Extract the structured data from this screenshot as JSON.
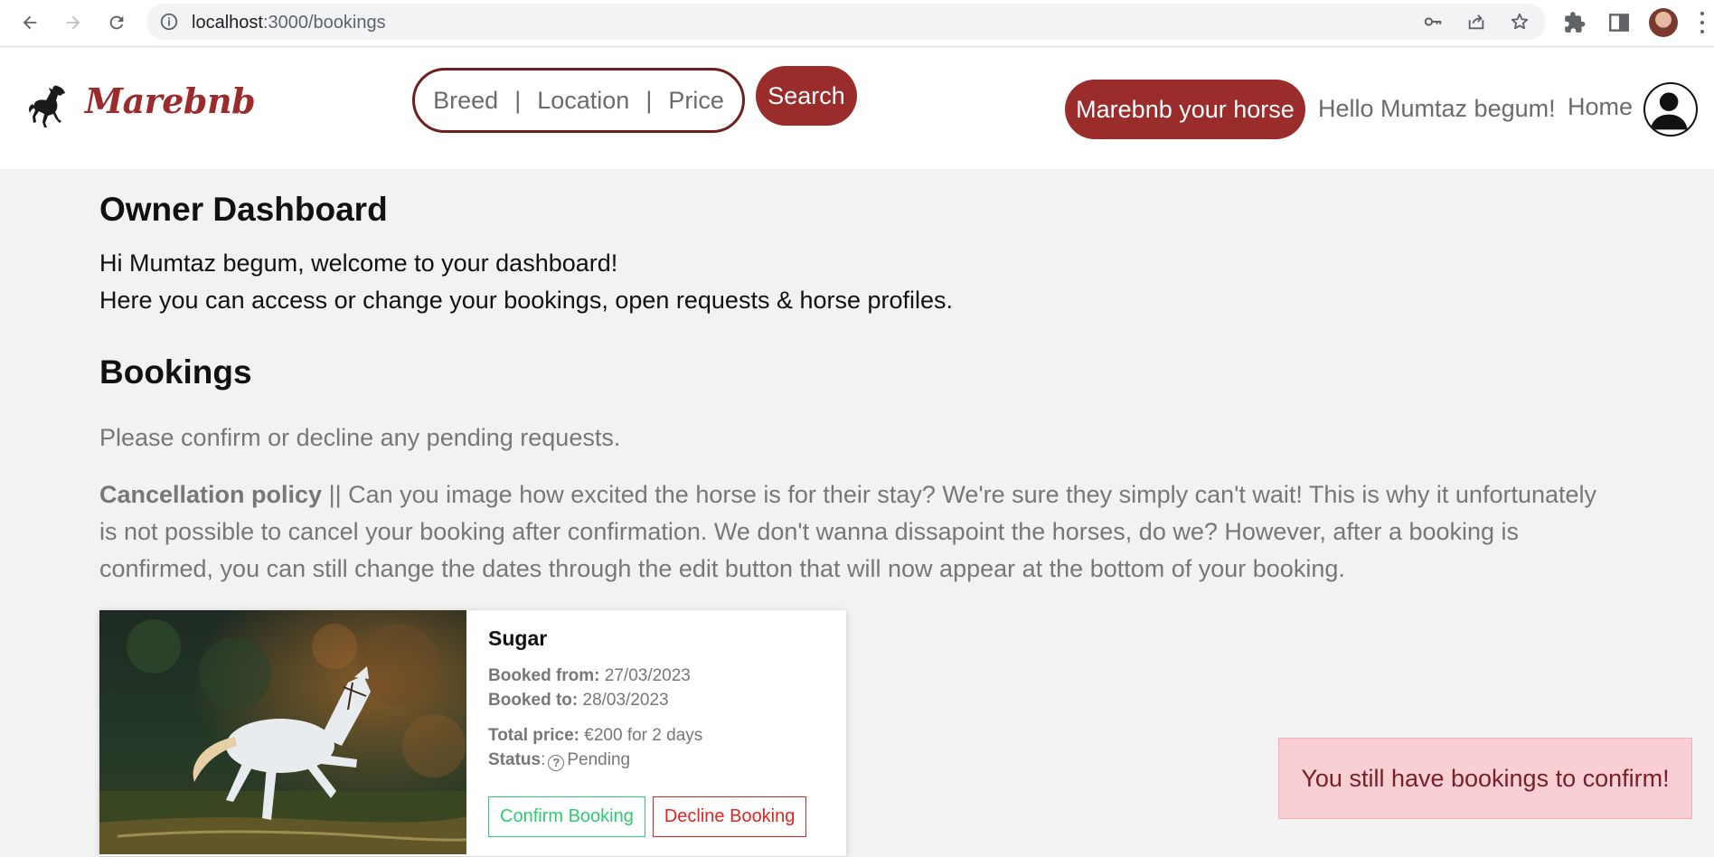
{
  "browser": {
    "url_host": "localhost",
    "url_path": ":3000/bookings",
    "icons": [
      "back-icon",
      "forward-icon",
      "reload-icon",
      "site-info-icon",
      "key-icon",
      "share-icon",
      "star-icon",
      "extensions-icon",
      "side-panel-icon",
      "profile-avatar",
      "menu-icon"
    ]
  },
  "header": {
    "brand": "Marebnb",
    "search": {
      "breed": "Breed",
      "location": "Location",
      "price": "Price",
      "separator": "|",
      "button": "Search"
    },
    "host_button": "Marebnb your horse",
    "greeting": "Hello Mumtaz begum!",
    "home_link": "Home"
  },
  "dashboard": {
    "title": "Owner Dashboard",
    "welcome_line1": "Hi Mumtaz begum, welcome to your dashboard!",
    "welcome_line2": "Here you can access or change your bookings, open requests & horse profiles."
  },
  "bookings": {
    "title": "Bookings",
    "note": "Please confirm or decline any pending requests.",
    "policy_label": "Cancellation policy",
    "policy_text": " || Can you image how excited the horse is for their stay? We're sure they simply can't wait! This is why it unfortunately is not possible to cancel your booking after confirmation. We don't wanna dissapoint the horses, do we? However, after a booking is confirmed, you can still change the dates through the edit button that will now appear at the bottom of your booking.",
    "items": [
      {
        "horse_name": "Sugar",
        "booked_from_label": "Booked from:",
        "booked_from": " 27/03/2023",
        "booked_to_label": "Booked to:",
        "booked_to": " 28/03/2023",
        "total_price_label": "Total price:",
        "total_price": " €200 for 2 days",
        "status_label": "Status",
        "status_sep": ":",
        "status": "Pending",
        "confirm_label": "Confirm Booking",
        "decline_label": "Decline Booking"
      }
    ]
  },
  "alert": {
    "text": "You still have bookings to confirm!"
  },
  "colors": {
    "brand": "#9b2c2c",
    "confirm": "#2ecc71",
    "decline": "#e02424",
    "alert_bg": "#f8cfd2",
    "page_bg": "#f2f2f2"
  }
}
